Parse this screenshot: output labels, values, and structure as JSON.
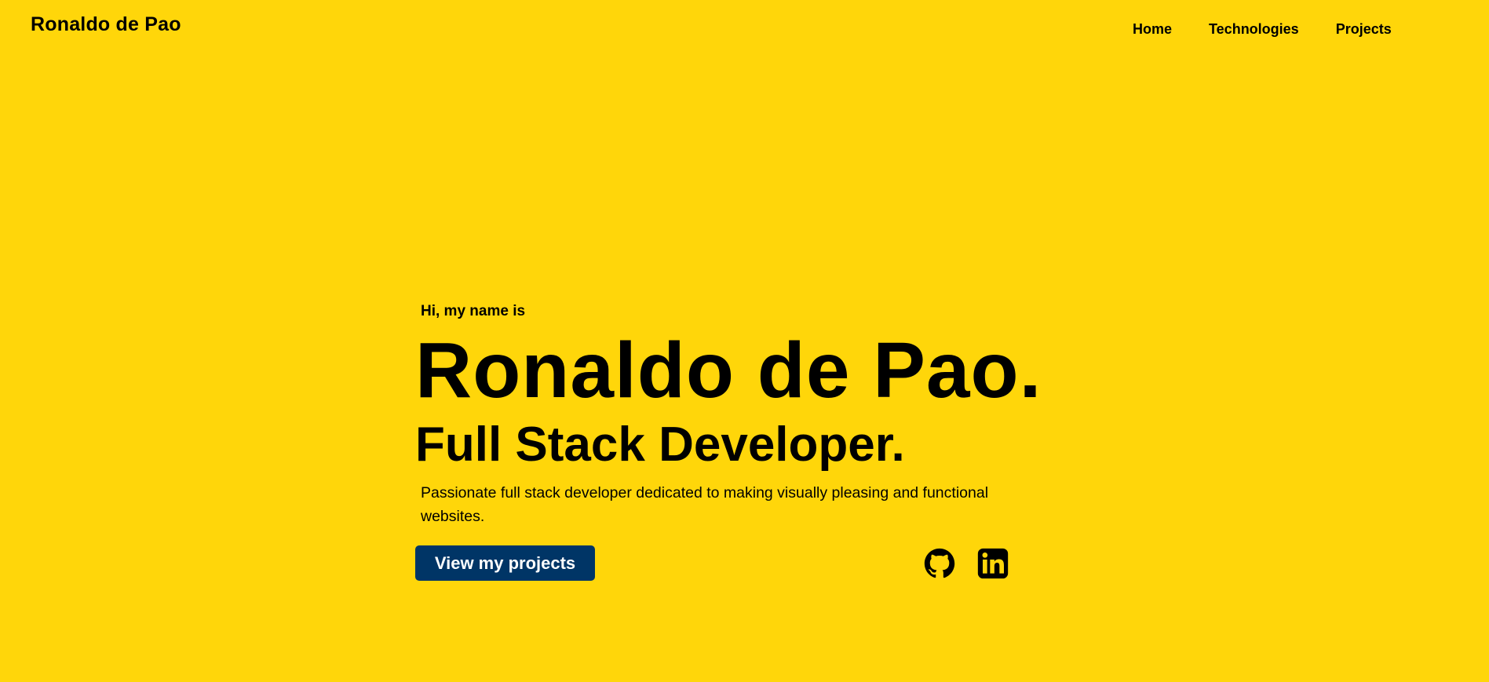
{
  "header": {
    "brand": "Ronaldo de Pao",
    "nav": {
      "home": "Home",
      "technologies": "Technologies",
      "projects": "Projects"
    }
  },
  "hero": {
    "greeting": "Hi, my name is",
    "name": "Ronaldo de Pao.",
    "role": "Full Stack Developer.",
    "description": "Passionate full stack developer dedicated to making visually pleasing and functional websites.",
    "cta_label": "View my projects"
  },
  "social": {
    "icons": [
      "github-icon",
      "linkedin-icon"
    ]
  },
  "colors": {
    "background": "#FFD60A",
    "button": "#003566",
    "text": "#000000",
    "button_text": "#FFFFFF"
  }
}
